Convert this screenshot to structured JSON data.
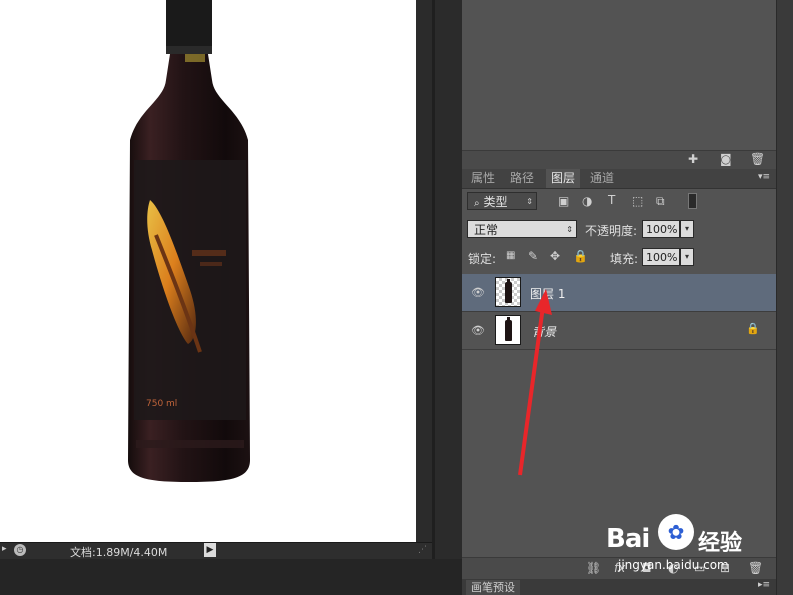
{
  "status_bar": {
    "doc_info": "文档:1.89M/4.40M"
  },
  "bottle_label": {
    "volume": "750 ml"
  },
  "layers_panel": {
    "tabs": [
      {
        "label": "属性",
        "active": false
      },
      {
        "label": "路径",
        "active": false
      },
      {
        "label": "图层",
        "active": true
      },
      {
        "label": "通道",
        "active": false
      }
    ],
    "filter_type": "类型",
    "filter_icon": "search-icon",
    "blend_mode": "正常",
    "opacity_label": "不透明度:",
    "opacity_value": "100%",
    "lock_label": "锁定:",
    "fill_label": "填充:",
    "fill_value": "100%",
    "layers": [
      {
        "name": "图层 1",
        "selected": true,
        "visible": true,
        "locked": false
      },
      {
        "name": "背景",
        "selected": false,
        "visible": true,
        "locked": true
      }
    ]
  },
  "bottom_panel": {
    "tab_label": "画笔预设"
  },
  "watermark": {
    "brand": "Bai",
    "brand_suffix": "经验",
    "url": "jingyan.baidu.com"
  },
  "colors": {
    "accent_arrow": "#e8262a",
    "selected_layer": "#5f6b7c",
    "panel_bg": "#535353"
  }
}
